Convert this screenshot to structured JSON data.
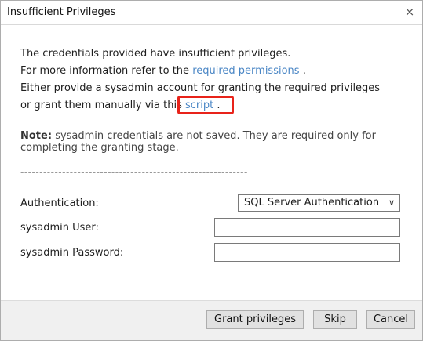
{
  "window": {
    "title": "Insufficient Privileges",
    "close_glyph": "×"
  },
  "message": {
    "line1": "The credentials provided have insufficient privileges.",
    "line2_prefix": "For more information refer to the",
    "line2_link": "required permissions",
    "line2_suffix": ".",
    "line3": "Either provide a sysadmin account for granting the required privileges",
    "line4_prefix": "or grant them manually via this",
    "line4_link": "script",
    "line4_suffix": "."
  },
  "note": {
    "label": "Note:",
    "text": "sysadmin credentials are not saved. They are required only for completing the granting stage."
  },
  "separator": "------------------------------------------------------------",
  "form": {
    "authentication_label": "Authentication:",
    "authentication_value": "SQL Server Authentication",
    "chevron_glyph": "∨",
    "user_label": "sysadmin User:",
    "user_value": "",
    "password_label": "sysadmin Password:",
    "password_value": ""
  },
  "buttons": {
    "grant": "Grant privileges",
    "skip": "Skip",
    "cancel": "Cancel"
  },
  "colors": {
    "link": "#4a86c5",
    "highlight": "#e8231a"
  }
}
